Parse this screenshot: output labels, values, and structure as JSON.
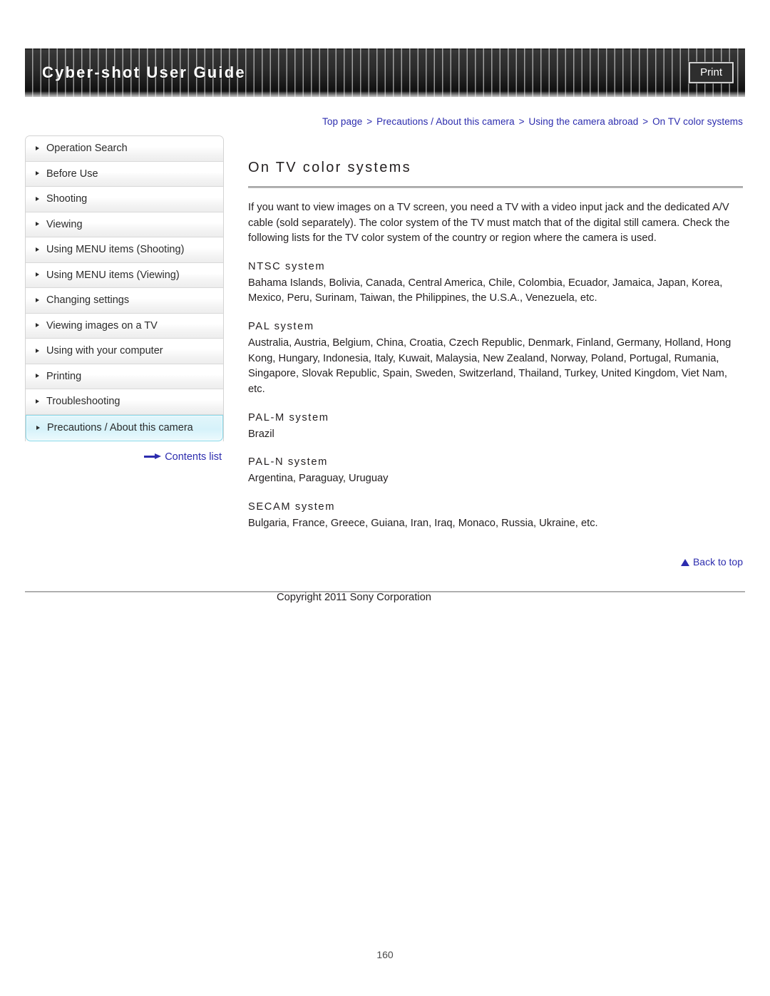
{
  "header": {
    "title": "Cyber-shot User Guide",
    "print_label": "Print"
  },
  "breadcrumb": {
    "items": [
      "Top page",
      "Precautions / About this camera",
      "Using the camera abroad",
      "On TV color systems"
    ],
    "separator": ">"
  },
  "sidebar": {
    "items": [
      {
        "label": "Operation Search",
        "active": false
      },
      {
        "label": "Before Use",
        "active": false
      },
      {
        "label": "Shooting",
        "active": false
      },
      {
        "label": "Viewing",
        "active": false
      },
      {
        "label": "Using MENU items (Shooting)",
        "active": false
      },
      {
        "label": "Using MENU items (Viewing)",
        "active": false
      },
      {
        "label": "Changing settings",
        "active": false
      },
      {
        "label": "Viewing images on a TV",
        "active": false
      },
      {
        "label": "Using with your computer",
        "active": false
      },
      {
        "label": "Printing",
        "active": false
      },
      {
        "label": "Troubleshooting",
        "active": false
      },
      {
        "label": "Precautions / About this camera",
        "active": true
      }
    ],
    "contents_list_label": "Contents list"
  },
  "main": {
    "title": "On TV color systems",
    "intro": "If you want to view images on a TV screen, you need a TV with a video input jack and the dedicated A/V cable (sold separately). The color system of the TV must match that of the digital still camera. Check the following lists for the TV color system of the country or region where the camera is used.",
    "sections": [
      {
        "heading": "NTSC system",
        "body": "Bahama Islands, Bolivia, Canada, Central America, Chile, Colombia, Ecuador, Jamaica, Japan, Korea, Mexico, Peru, Surinam, Taiwan, the Philippines, the U.S.A., Venezuela, etc."
      },
      {
        "heading": "PAL system",
        "body": "Australia, Austria, Belgium, China, Croatia, Czech Republic, Denmark, Finland, Germany, Holland, Hong Kong, Hungary, Indonesia, Italy, Kuwait, Malaysia, New Zealand, Norway, Poland, Portugal, Rumania, Singapore, Slovak Republic, Spain, Sweden, Switzerland, Thailand, Turkey, United Kingdom, Viet Nam, etc."
      },
      {
        "heading": "PAL-M system",
        "body": "Brazil"
      },
      {
        "heading": "PAL-N system",
        "body": "Argentina, Paraguay, Uruguay"
      },
      {
        "heading": "SECAM system",
        "body": "Bulgaria, France, Greece, Guiana, Iran, Iraq, Monaco, Russia, Ukraine, etc."
      }
    ],
    "back_to_top_label": "Back to top"
  },
  "footer": {
    "copyright": "Copyright 2011 Sony Corporation",
    "page_number": "160"
  },
  "colors": {
    "link": "#2c2cae",
    "banner_bg": "#2a2a2a",
    "active_nav": "#d6f2fa"
  }
}
